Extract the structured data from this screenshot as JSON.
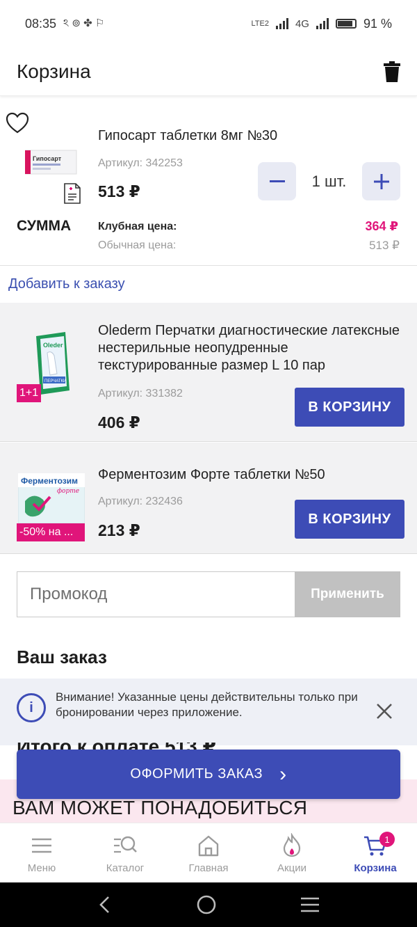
{
  "status_bar": {
    "time": "08:35",
    "left_icons": "ঽ ⊚ ✤ ⚐",
    "network": "4G",
    "battery": "91 %",
    "volte": "LTE2"
  },
  "header": {
    "title": "Корзина",
    "trash_icon": "trash-icon"
  },
  "cart_item": {
    "name": "Гипосарт таблетки 8мг №30",
    "sku": "Артикул: 342253",
    "price": "513 ₽",
    "quantity": "1 шт.",
    "sum_label": "СУММА",
    "club_label": "Клубная цена:",
    "club_value": "364 ₽",
    "regular_label": "Обычная цена:",
    "regular_value": "513 ₽",
    "box_label": "Гипосарт"
  },
  "add_to_order": {
    "label": "Добавить к заказу",
    "items": [
      {
        "name": "Olederm Перчатки диагностические латексные нестерильные неопудренные текстурированные размер L 10 пар",
        "sku": "Артикул: 331382",
        "price": "406 ₽",
        "badge": "1+1",
        "button": "В КОРЗИНУ",
        "box_label": "Oleder",
        "box_sub": "ПЕРЧАТКИ"
      },
      {
        "name": "Ферментозим Форте таблетки №50",
        "sku": "Артикул: 232436",
        "price": "213 ₽",
        "badge": "-50% на ...",
        "button": "В КОРЗИНУ",
        "box_label": "Ферментозим",
        "box_sub": "форте"
      }
    ]
  },
  "promo": {
    "placeholder": "Промокод",
    "apply": "Применить"
  },
  "order": {
    "title": "Ваш заказ",
    "total_peek": "Итого к оплате                              513 ₽"
  },
  "notice": {
    "text": "Внимание! Указанные цены действительны только при бронировании через приложение.",
    "icon": "i"
  },
  "checkout": {
    "label": "ОФОРМИТЬ ЗАКАЗ",
    "arrow": "›"
  },
  "recommend": {
    "title": "ВАМ МОЖЕТ ПОНАДОБИТЬСЯ"
  },
  "bottom_nav": {
    "items": [
      {
        "label": "Меню",
        "icon": "menu-icon"
      },
      {
        "label": "Каталог",
        "icon": "catalog-search-icon"
      },
      {
        "label": "Главная",
        "icon": "home-icon"
      },
      {
        "label": "Акции",
        "icon": "flame-icon"
      },
      {
        "label": "Корзина",
        "icon": "cart-icon"
      }
    ],
    "cart_count": "1"
  },
  "colors": {
    "accent": "#3d4cb6",
    "pink": "#e0157a",
    "apply_disabled": "#c1c1c1"
  }
}
